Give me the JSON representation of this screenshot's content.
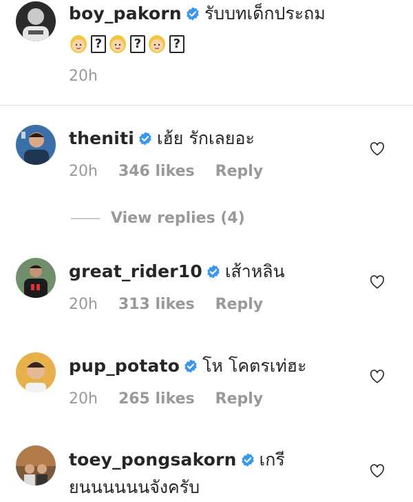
{
  "caption": {
    "username": "boy_pakorn",
    "text": "รับบทเด็กประถม",
    "emoji": [
      "woman-blonde-emoji",
      "unknown-glyph",
      "woman-blonde-emoji",
      "unknown-glyph",
      "woman-blonde-emoji",
      "unknown-glyph"
    ],
    "unknown_glyph": "?",
    "time": "20h"
  },
  "comments": [
    {
      "username": "theniti",
      "text": "เฮ้ย รักเลยอะ",
      "time": "20h",
      "likes": "346 likes",
      "reply": "Reply"
    },
    {
      "username": "great_rider10",
      "text": "เส้าหลิน",
      "time": "20h",
      "likes": "313 likes",
      "reply": "Reply"
    },
    {
      "username": "pup_potato",
      "text": "โห โคตรเท่ฮะ",
      "time": "20h",
      "likes": "265 likes",
      "reply": "Reply"
    },
    {
      "username": "toey_pongsakorn",
      "text": "เกรี",
      "text_line2": "ยนนนนนนจังครับ"
    }
  ],
  "view_replies": "View replies (4)",
  "colors": {
    "verified": "#3897f0",
    "meta": "#999999",
    "text": "#262626",
    "divider": "#dbdbdb"
  }
}
